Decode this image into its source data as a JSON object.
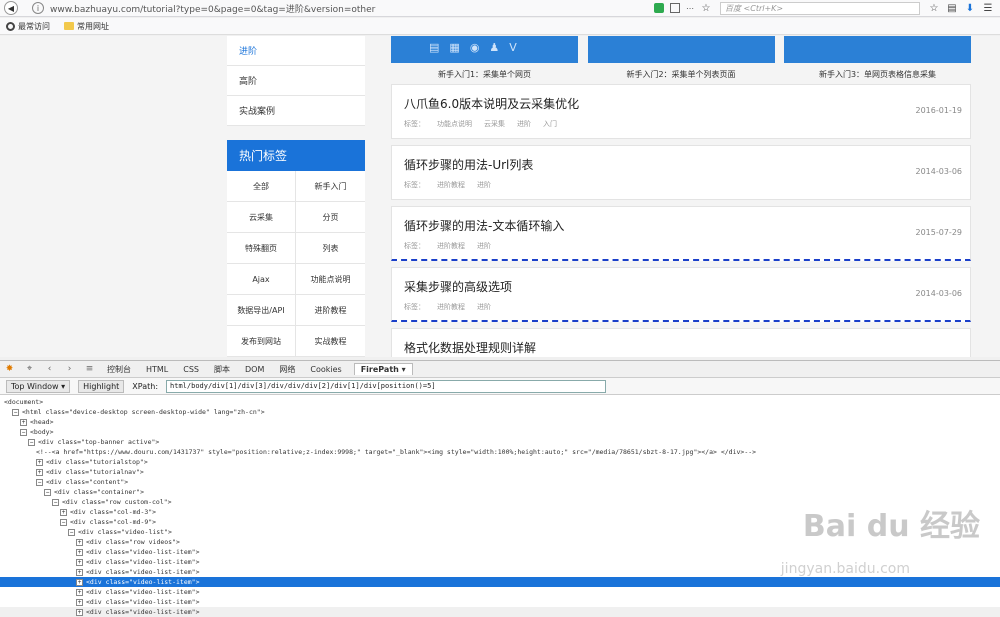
{
  "browser": {
    "url": "www.bazhuayu.com/tutorial?type=0&page=0&tag=进阶&version=other",
    "search_placeholder": "百度 <Ctrl+K>",
    "bookmarks": [
      "最常访问",
      "常用网址"
    ]
  },
  "sidebar": {
    "menu": [
      "进阶",
      "高阶",
      "实战案例"
    ],
    "hot_title": "热门标签",
    "tags": [
      "全部",
      "新手入门",
      "云采集",
      "分页",
      "特殊翻页",
      "列表",
      "Ajax",
      "功能点说明",
      "数据导出/API",
      "进阶教程",
      "发布到网站",
      "实战教程"
    ]
  },
  "thumbs": [
    "新手入门1：采集单个网页",
    "新手入门2：采集单个列表页面",
    "新手入门3：单网页表格信息采集"
  ],
  "articles": [
    {
      "title": "八爪鱼6.0版本说明及云采集优化",
      "meta": [
        "标签：",
        "功能点说明",
        "云采集",
        "进阶",
        "入门"
      ],
      "date": "2016-01-19"
    },
    {
      "title": "循环步骤的用法-Url列表",
      "meta": [
        "标签：",
        "进阶教程",
        "进阶"
      ],
      "date": "2014-03-06"
    },
    {
      "title": "循环步骤的用法-文本循环输入",
      "meta": [
        "标签：",
        "进阶教程",
        "进阶"
      ],
      "date": "2015-07-29"
    },
    {
      "title": "采集步骤的高级选项",
      "meta": [
        "标签：",
        "进阶教程",
        "进阶"
      ],
      "date": "2014-03-06"
    },
    {
      "title": "格式化数据处理规则详解"
    }
  ],
  "devtools": {
    "tabs": [
      "控制台",
      "HTML",
      "CSS",
      "脚本",
      "DOM",
      "网络",
      "Cookies",
      "FirePath ▾"
    ],
    "top_window": "Top Window ▾",
    "highlight": "Highlight",
    "xpath_label": "XPath:",
    "xpath": "html/body/div[1]/div[3]/div/div/div[2]/div[1]/div[position()=5]"
  },
  "tree": [
    {
      "indent": 0,
      "toggle": "",
      "text": "<document>"
    },
    {
      "indent": 1,
      "toggle": "⊟",
      "text": "<html class=\"device-desktop screen-desktop-wide\" lang=\"zh-cn\">"
    },
    {
      "indent": 2,
      "toggle": "⊞",
      "text": "<head>"
    },
    {
      "indent": 2,
      "toggle": "⊟",
      "text": "<body>"
    },
    {
      "indent": 3,
      "toggle": "⊟",
      "text": "<div class=\"top-banner active\">"
    },
    {
      "indent": 4,
      "toggle": "",
      "text": "<!--<a href=\"https://www.douru.com/1431737\" style=\"position:relative;z-index:9998;\" target=\"_blank\"><img style=\"width:100%;height:auto;\" src=\"/media/78651/sbzt-8-17.jpg\"></a> </div>-->"
    },
    {
      "indent": 4,
      "toggle": "⊞",
      "text": "<div class=\"tutorialstop\">"
    },
    {
      "indent": 4,
      "toggle": "⊞",
      "text": "<div class=\"tutorialnav\">"
    },
    {
      "indent": 4,
      "toggle": "⊟",
      "text": "<div class=\"content\">"
    },
    {
      "indent": 5,
      "toggle": "⊟",
      "text": "<div class=\"container\">"
    },
    {
      "indent": 6,
      "toggle": "⊟",
      "text": "<div class=\"row custom-col\">"
    },
    {
      "indent": 7,
      "toggle": "⊞",
      "text": "<div class=\"col-md-3\">"
    },
    {
      "indent": 7,
      "toggle": "⊟",
      "text": "<div class=\"col-md-9\">"
    },
    {
      "indent": 8,
      "toggle": "⊟",
      "text": "<div class=\"video-list\">"
    },
    {
      "indent": 9,
      "toggle": "⊞",
      "text": "<div class=\"row videos\">"
    },
    {
      "indent": 9,
      "toggle": "⊞",
      "text": "<div class=\"video-list-item\">"
    },
    {
      "indent": 9,
      "toggle": "⊞",
      "text": "<div class=\"video-list-item\">"
    },
    {
      "indent": 9,
      "toggle": "⊞",
      "text": "<div class=\"video-list-item\">"
    },
    {
      "indent": 9,
      "toggle": "⊞",
      "text": "<div class=\"video-list-item\">",
      "selected": true
    },
    {
      "indent": 9,
      "toggle": "⊞",
      "text": "<div class=\"video-list-item\">"
    },
    {
      "indent": 9,
      "toggle": "⊞",
      "text": "<div class=\"video-list-item\">"
    },
    {
      "indent": 9,
      "toggle": "⊞",
      "text": "<div class=\"video-list-item\">"
    }
  ],
  "watermark": "Bai du 经验",
  "watermark_sub": "jingyan.baidu.com"
}
